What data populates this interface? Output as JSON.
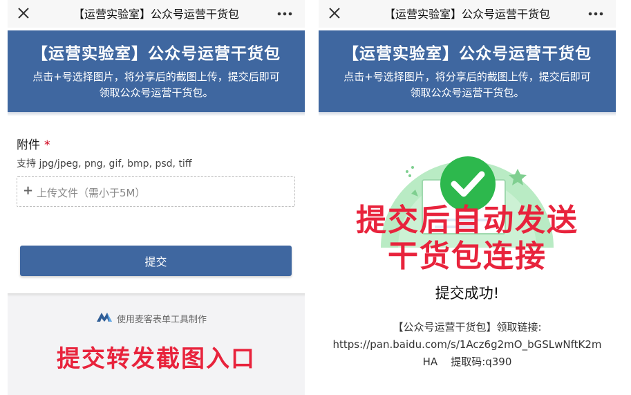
{
  "colors": {
    "accent": "#3f67a0",
    "caption_red": "#e8233c",
    "required_red": "#d0021b",
    "success_green": "#2db84d"
  },
  "left": {
    "topbar": {
      "title": "【运营实验室】公众号运营干货包",
      "close_icon": "close-icon",
      "more_icon": "more-icon"
    },
    "banner": {
      "title": "【运营实验室】公众号运营干货包",
      "desc_line1": "点击+号选择图片，将分享后的截图上传，提交后即可",
      "desc_line2": "领取公众号运营干货包。"
    },
    "form": {
      "field_label": "附件",
      "required_mark": "*",
      "hint": "支持 jpg/jpeg, png, gif, bmp, psd, tiff",
      "upload_plus": "+",
      "upload_text": "上传文件（需小于5M）",
      "submit_label": "提交"
    },
    "footer": {
      "maker_text": "使用麦客表单工具制作",
      "overlay_caption": "提交转发截图入口"
    }
  },
  "right": {
    "topbar": {
      "title": "【运营实验室】公众号运营干货包",
      "close_icon": "close-icon",
      "more_icon": "more-icon"
    },
    "banner": {
      "title": "【运营实验室】公众号运营干货包",
      "desc_line1": "点击+号选择图片，将分享后的截图上传，提交后即可",
      "desc_line2": "领取公众号运营干货包。"
    },
    "success": {
      "illustration_icon": "checkmark-icon",
      "overlay_line1": "提交后自动发送",
      "overlay_line2": "干货包连接",
      "message": "提交成功!",
      "result_line1": "【公众号运营干货包】领取链接:",
      "result_line2": "https://pan.baidu.com/s/1Acz6g2mO_bGSLwNftK2m",
      "result_line3": "HA    提取码:q390"
    }
  }
}
